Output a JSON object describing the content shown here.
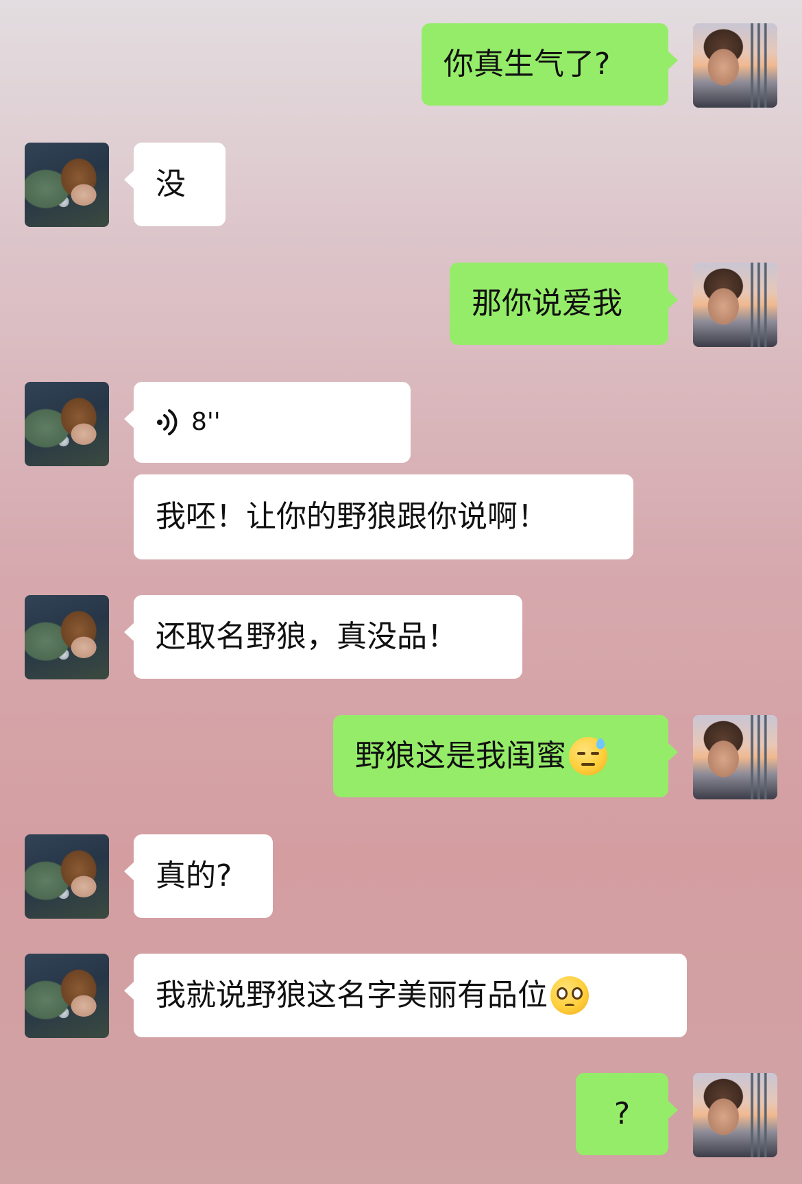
{
  "messages": [
    {
      "side": "out",
      "type": "text",
      "text": "你真生气了?"
    },
    {
      "side": "in",
      "type": "text",
      "text": "没"
    },
    {
      "side": "out",
      "type": "text",
      "text": "那你说爱我"
    },
    {
      "side": "in",
      "type": "voice",
      "duration": "8''"
    },
    {
      "side": "in",
      "type": "text",
      "text": "我呸！让你的野狼跟你说啊！"
    },
    {
      "side": "in",
      "type": "text",
      "text": "还取名野狼，真没品！"
    },
    {
      "side": "out",
      "type": "text",
      "text": "野狼这是我闺蜜",
      "emoji": "downcast-sweat-face"
    },
    {
      "side": "in",
      "type": "text",
      "text": "真的?"
    },
    {
      "side": "in",
      "type": "text",
      "text": "我就说野狼这名字美丽有品位",
      "emoji": "pleading-face"
    },
    {
      "side": "out",
      "type": "text",
      "text": "?"
    }
  ],
  "colors": {
    "outgoing_bubble": "#95ec69",
    "incoming_bubble": "#ffffff"
  }
}
